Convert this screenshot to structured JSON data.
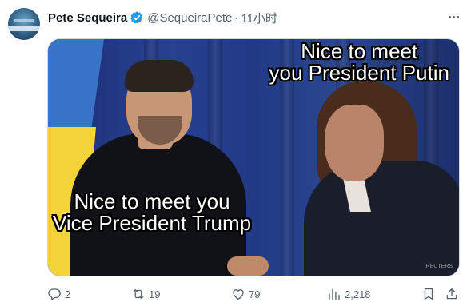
{
  "tweet": {
    "author_name": "Pete Sequeira",
    "handle": "@SequeiraPete",
    "separator": "·",
    "time": "11小时",
    "verified": true
  },
  "media": {
    "caption_top_line1": "Nice to meet",
    "caption_top_line2": "you President Putin",
    "caption_bottom_line1": "Nice to meet you",
    "caption_bottom_line2": "Vice President Trump",
    "watermark": "REUTERS"
  },
  "actions": {
    "replies": "2",
    "retweets": "19",
    "likes": "79",
    "views": "2,218"
  },
  "icons": {
    "verified": "verified-badge-icon",
    "more": "more-icon",
    "reply": "reply-icon",
    "retweet": "retweet-icon",
    "like": "like-icon",
    "views": "views-icon",
    "bookmark": "bookmark-icon",
    "share": "share-icon"
  },
  "colors": {
    "verified": "#1d9bf0",
    "secondary_text": "#536471",
    "primary_text": "#0f1419"
  }
}
